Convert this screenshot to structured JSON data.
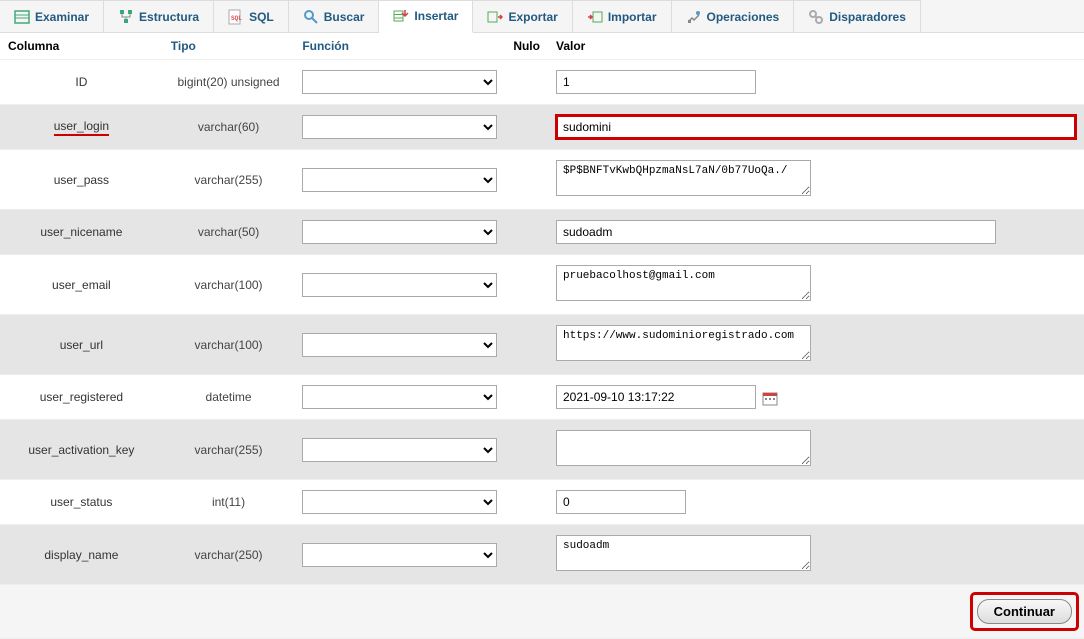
{
  "tabs": [
    {
      "label": "Examinar"
    },
    {
      "label": "Estructura"
    },
    {
      "label": "SQL"
    },
    {
      "label": "Buscar"
    },
    {
      "label": "Insertar"
    },
    {
      "label": "Exportar"
    },
    {
      "label": "Importar"
    },
    {
      "label": "Operaciones"
    },
    {
      "label": "Disparadores"
    }
  ],
  "headers": {
    "column": "Columna",
    "type": "Tipo",
    "function": "Función",
    "null": "Nulo",
    "value": "Valor"
  },
  "rows": [
    {
      "col": "ID",
      "type": "bigint(20) unsigned",
      "value": "1",
      "kind": "text-short",
      "underlined": false
    },
    {
      "col": "user_login",
      "type": "varchar(60)",
      "value": "sudomini",
      "kind": "text-full",
      "underlined": true,
      "highlight": true
    },
    {
      "col": "user_pass",
      "type": "varchar(255)",
      "value": "$P$BNFTvKwbQHpzmaNsL7aN/0b77UoQa./",
      "kind": "textarea",
      "underlined": false
    },
    {
      "col": "user_nicename",
      "type": "varchar(50)",
      "value": "sudoadm",
      "kind": "text-mid",
      "underlined": false
    },
    {
      "col": "user_email",
      "type": "varchar(100)",
      "value": "pruebacolhost@gmail.com",
      "kind": "textarea",
      "underlined": false
    },
    {
      "col": "user_url",
      "type": "varchar(100)",
      "value": "https://www.sudominioregistrado.com",
      "kind": "textarea",
      "underlined": false
    },
    {
      "col": "user_registered",
      "type": "datetime",
      "value": "2021-09-10 13:17:22",
      "kind": "datetime",
      "underlined": false
    },
    {
      "col": "user_activation_key",
      "type": "varchar(255)",
      "value": "",
      "kind": "textarea",
      "underlined": false
    },
    {
      "col": "user_status",
      "type": "int(11)",
      "value": "0",
      "kind": "text-tiny",
      "underlined": false
    },
    {
      "col": "display_name",
      "type": "varchar(250)",
      "value": "sudoadm",
      "kind": "textarea",
      "underlined": false
    }
  ],
  "buttons": {
    "continue": "Continuar"
  },
  "active_tab_index": 4
}
